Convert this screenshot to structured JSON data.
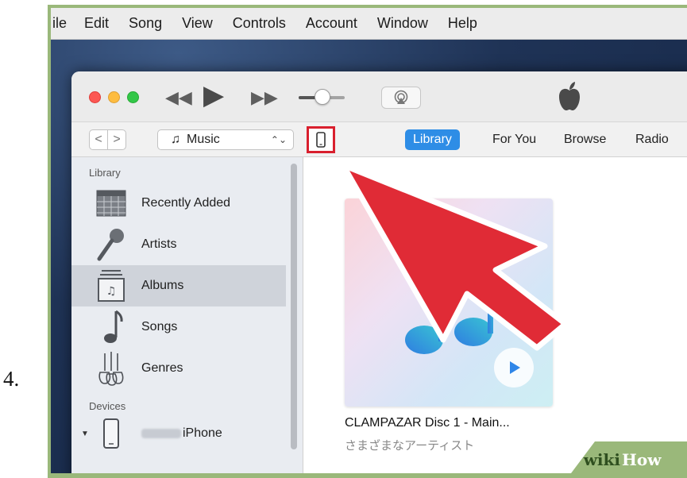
{
  "step": {
    "number": "4."
  },
  "menubar": {
    "items": [
      "ile",
      "Edit",
      "Song",
      "View",
      "Controls",
      "Account",
      "Window",
      "Help"
    ]
  },
  "toolbar": {
    "rewind_icon": "rewind-icon",
    "play_icon": "play-icon",
    "fast_forward_icon": "fast-forward-icon",
    "airplay_icon": "airplay-icon",
    "volume_level": 0.4
  },
  "navbar": {
    "back_label": "<",
    "forward_label": ">",
    "media_select": "Music",
    "device_icon": "iphone-icon",
    "tabs": [
      {
        "label": "Library",
        "active": true
      },
      {
        "label": "For You",
        "active": false
      },
      {
        "label": "Browse",
        "active": false
      },
      {
        "label": "Radio",
        "active": false
      }
    ]
  },
  "sidebar": {
    "library_header": "Library",
    "items": [
      {
        "label": "Recently Added",
        "icon": "calendar-grid-icon",
        "selected": false
      },
      {
        "label": "Artists",
        "icon": "microphone-icon",
        "selected": false
      },
      {
        "label": "Albums",
        "icon": "album-stack-icon",
        "selected": true
      },
      {
        "label": "Songs",
        "icon": "music-note-icon",
        "selected": false
      },
      {
        "label": "Genres",
        "icon": "guitars-icon",
        "selected": false
      }
    ],
    "devices_header": "Devices",
    "device": {
      "label": "iPhone",
      "icon": "iphone-icon"
    }
  },
  "content": {
    "album_title": "CLAMPAZAR Disc 1 - Main...",
    "album_artist": "さまざまなアーティスト",
    "album_play_icon": "play-icon"
  },
  "annotation": {
    "highlight_color": "#d9202e",
    "arrow_color": "#e02b36"
  },
  "watermark": {
    "wiki": "wiki",
    "how": "How"
  }
}
